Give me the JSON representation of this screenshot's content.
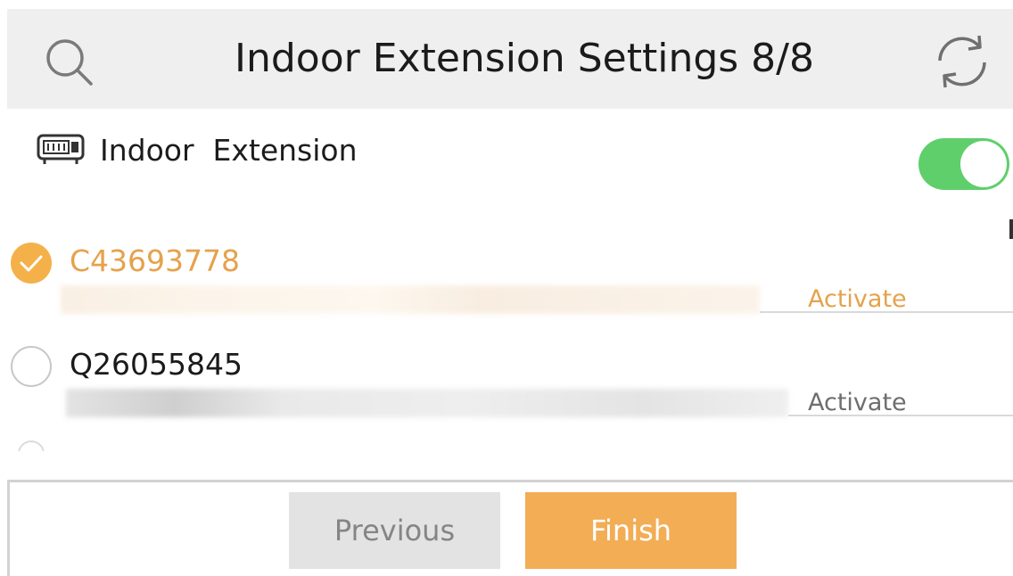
{
  "header": {
    "title": "Indoor Extension Settings 8/8",
    "search_icon": "search-icon",
    "refresh_icon": "refresh-icon"
  },
  "device_section": {
    "icon": "indoor-extension-device-icon",
    "label": "Indoor  Extension",
    "toggle_on": true
  },
  "devices": [
    {
      "serial": "C43693778",
      "selected": true,
      "action": "Activate"
    },
    {
      "serial": "Q26055845",
      "selected": false,
      "action": "Activate"
    }
  ],
  "footer": {
    "previous_label": "Previous",
    "finish_label": "Finish"
  },
  "colors": {
    "accent": "#f2ad55",
    "selected_text": "#e5a24c",
    "toggle_on": "#5fcf6c",
    "header_bg": "#efefef",
    "button_disabled": "#e3e3e3"
  }
}
